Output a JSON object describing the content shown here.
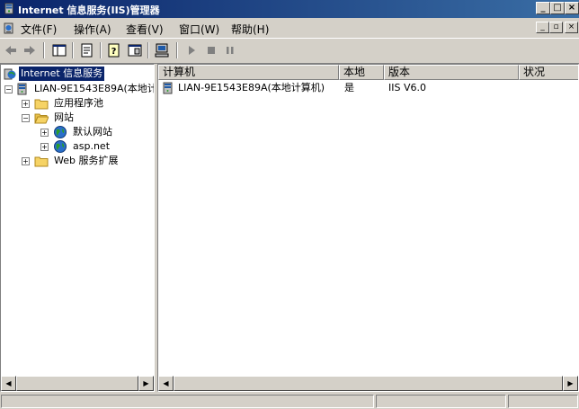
{
  "window": {
    "title": "Internet 信息服务(IIS)管理器",
    "min": "_",
    "max": "□",
    "close": "×"
  },
  "menu": {
    "items": [
      "文件(F)",
      "操作(A)",
      "查看(V)",
      "窗口(W)",
      "帮助(H)"
    ],
    "mdi_min": "_",
    "mdi_restore": "▫",
    "mdi_close": "×"
  },
  "tree": {
    "root": "Internet 信息服务",
    "computer": "LIAN-9E1543E89A(本地计",
    "app_pools": "应用程序池",
    "websites": "网站",
    "default_site": "默认网站",
    "asp_net": "asp.net",
    "web_ext": "Web 服务扩展"
  },
  "list": {
    "columns": [
      "计算机",
      "本地",
      "版本",
      "状况"
    ],
    "rows": [
      {
        "computer": "LIAN-9E1543E89A(本地计算机)",
        "local": "是",
        "version": "IIS V6.0",
        "status": ""
      }
    ]
  },
  "colors": {
    "title_start": "#0a246a",
    "title_end": "#3a6ea5",
    "chrome": "#d4d0c8",
    "selection": "#0a246a"
  }
}
